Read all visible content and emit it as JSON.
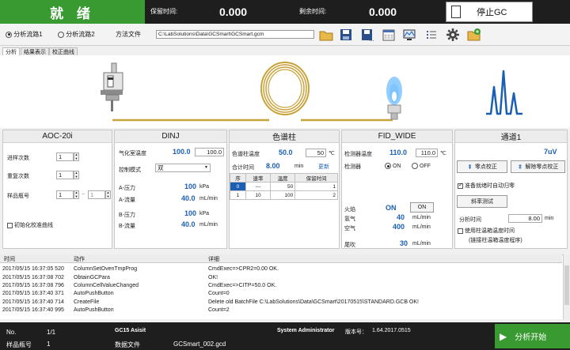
{
  "top": {
    "status": "就 绪",
    "retention_label": "保留时间:",
    "retention_value": "0.000",
    "remaining_label": "剩余时间:",
    "remaining_value": "0.000",
    "stop_label": "停止GC"
  },
  "toolbar": {
    "flow1": "分析流路1",
    "flow2": "分析流路2",
    "method_label": "方法文件",
    "method_path": "C:\\LabSolutions\\Data\\GCSmart\\GCSmart.gcm",
    "icons": [
      "folder-open-icon",
      "save-icon",
      "save-as-icon",
      "calendar-icon",
      "monitor-icon",
      "list-icon",
      "gear-icon",
      "add-folder-icon"
    ]
  },
  "tabs": [
    "分析",
    "结果表示",
    "校正曲线"
  ],
  "aoc": {
    "title": "AOC-20i",
    "inject_count_label": "进样次数",
    "inject_count": "1",
    "repeat_label": "重复次数",
    "repeat": "1",
    "vial_label": "样品瓶号",
    "vial_from": "1",
    "vial_to": "1",
    "calib_label": "初始化校准曲线"
  },
  "dinj": {
    "title": "DINJ",
    "temp_label": "气化室温度",
    "temp_actual": "100.0",
    "temp_set": "100.0",
    "mode_label": "控制模式",
    "mode_value": "双",
    "a_pressure_label": "A-压力",
    "a_pressure": "100",
    "a_pressure_unit": "kPa",
    "a_flow_label": "A-流量",
    "a_flow": "40.0",
    "a_flow_unit": "mL/min",
    "b_pressure_label": "B-压力",
    "b_pressure": "100",
    "b_pressure_unit": "kPa",
    "b_flow_label": "B-流量",
    "b_flow": "40.0",
    "b_flow_unit": "mL/min"
  },
  "column": {
    "title": "色谱柱",
    "temp_label": "色谱柱温度",
    "temp_actual": "50.0",
    "temp_set": "50",
    "temp_unit": "℃",
    "total_label": "合计时间",
    "total_value": "8.00",
    "total_unit": "min",
    "update": "更新",
    "headers": [
      "序",
      "速率",
      "温度",
      "保留时间"
    ],
    "rows": [
      [
        "0",
        "---",
        "50",
        "1"
      ],
      [
        "1",
        "10",
        "100",
        "2"
      ]
    ]
  },
  "fid": {
    "title": "FID_WIDE",
    "temp_label": "检测器温度",
    "temp_actual": "110.0",
    "temp_set": "110.0",
    "temp_unit": "℃",
    "detector_label": "检测器",
    "on": "ON",
    "off": "OFF",
    "flame_label": "火焰",
    "flame_state": "ON",
    "flame_btn": "ON",
    "h2_label": "氢气",
    "h2_value": "40",
    "h2_unit": "mL/min",
    "air_label": "空气",
    "air_value": "400",
    "air_unit": "mL/min",
    "makeup_label": "尾吹",
    "makeup_value": "30",
    "makeup_unit": "mL/min"
  },
  "channel": {
    "title": "通道1",
    "signal": "7uV",
    "zero_btn": "零点校正",
    "clear_zero_btn": "解除零点校正",
    "auto_zero_label": "准备就绪时自动归零",
    "slope_btn": "斜率测试",
    "analysis_time_label": "分析时间",
    "analysis_time": "8.00",
    "analysis_time_unit": "min",
    "use_column_label": "使用柱温箱温度时间",
    "use_column_sub": "(链接柱温箱温度程序)"
  },
  "log": {
    "headers": [
      "时间",
      "动作",
      "详细"
    ],
    "rows": [
      [
        "2017/05/15 16:37:05 520",
        "ColumnSetOvenTmpProg",
        "CmdExec=>CPR2=0.00 OK."
      ],
      [
        "2017/05/15 16:37:08 702",
        "ObtainGCPara",
        "OK!"
      ],
      [
        "2017/05/15 16:37:08 796",
        "ColumnCellValueChanged",
        "CmdExec=>CITP=50.0 OK."
      ],
      [
        "2017/05/15 16:37:40 371",
        "AutoPushButton",
        "Count=0"
      ],
      [
        "2017/05/15 16:37:40 714",
        "CreateFile",
        "Delete old BatchFile C:\\LabSolutions\\Data\\GCSmart\\20170515\\STANDARD.GCB OK!"
      ],
      [
        "2017/05/15 16:37:40 995",
        "AutoPushButton",
        "Count=2"
      ]
    ]
  },
  "status": {
    "no_label": "No.",
    "no_value": "1/1",
    "vial_label": "样品瓶号",
    "vial_value": "1",
    "app": "GC15 Asisit",
    "datafile_label": "数据文件",
    "datafile_value": "GCSmart_002.gcd",
    "user": "System Administrator",
    "version_label": "版本号：",
    "version_value": "1.64.2017.0515",
    "start": "分析开始"
  },
  "colors": {
    "green": "#3a9a32",
    "dark": "#1e1e1e",
    "blue": "#1a5fb4"
  }
}
